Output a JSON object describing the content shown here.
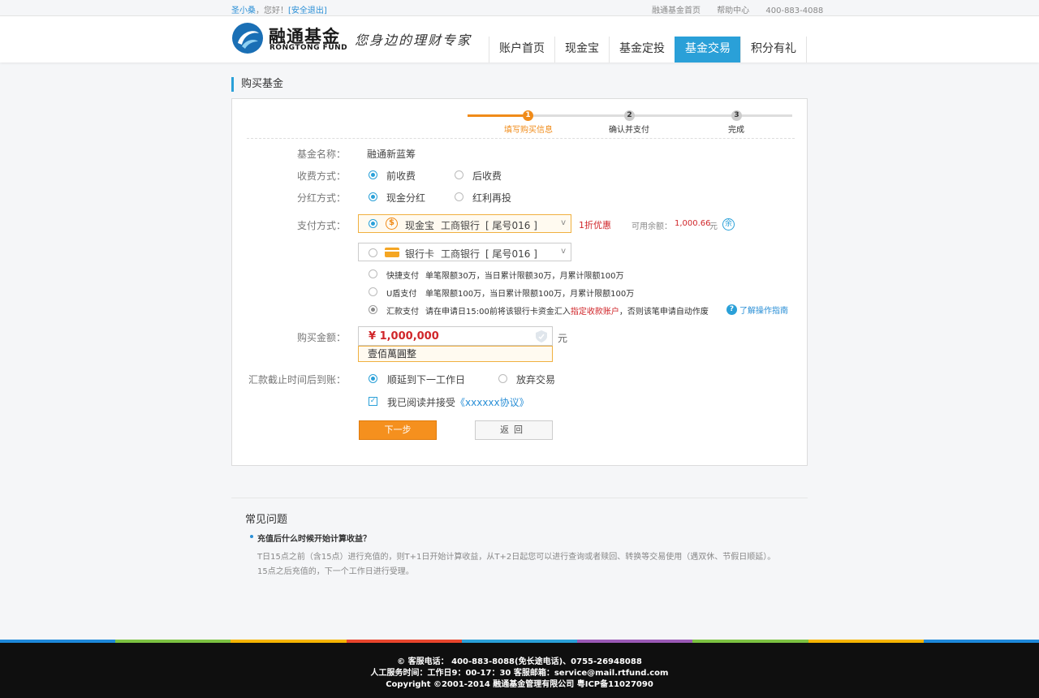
{
  "topbar": {
    "username": "圣小桑",
    "greeting": "，您好！",
    "logout": "[安全退出]",
    "links": [
      "融通基金首页",
      "帮助中心",
      "400-883-4088"
    ]
  },
  "brand": {
    "name_cn": "融通基金",
    "name_en": "RONGTONG FUND",
    "slogan": "您身边的理财专家"
  },
  "nav": {
    "items": [
      "账户首页",
      "现金宝",
      "基金定投",
      "基金交易",
      "积分有礼"
    ],
    "active": "基金交易"
  },
  "section_title": "购买基金",
  "steps": [
    "填写购买信息",
    "确认并支付",
    "完成"
  ],
  "form": {
    "fund_name_label": "基金名称：",
    "fund_name": "融通新蓝筹",
    "fee_label": "收费方式：",
    "fee_opt1": "前收费",
    "fee_opt2": "后收费",
    "div_label": "分红方式：",
    "div_opt1": "现金分红",
    "div_opt2": "红利再投",
    "pay_label": "支付方式：",
    "pay1": {
      "icon": "coin-icon",
      "name": "现金宝",
      "bank": "工商银行",
      "tail": "[ 尾号016 ]"
    },
    "discount": "1折优惠",
    "balance_label": "可用余额：",
    "balance": "1,000.66",
    "balance_unit": "元",
    "yu_icon": "余",
    "pay2": {
      "icon": "bank-card-icon",
      "name": "银行卡",
      "bank": "工商银行",
      "tail": "[ 尾号016 ]"
    },
    "methods": [
      {
        "name": "快捷支付",
        "desc": "单笔限额30万，当日累计限额30万，月累计限额100万"
      },
      {
        "name": "U盾支付",
        "desc": "单笔限额100万，当日累计限额100万，月累计限额100万"
      }
    ],
    "remit_name": "汇款支付",
    "remit_desc1": "请在申请日15:00前将该银行卡资金汇入",
    "remit_highlight": "指定收款账户",
    "remit_desc2": "，否则该笔申请自动作废",
    "guide_link": "了解操作指南",
    "amount_label": "购买金额：",
    "amount": "¥ 1,000,000",
    "amount_unit": "元",
    "amount_cn": "壹佰萬圓整",
    "cutoff_label": "汇款截止时间后到账：",
    "cutoff_opt1": "顺延到下一工作日",
    "cutoff_opt2": "放弃交易",
    "agree_text": "我已阅读并接受",
    "agree_link": "《xxxxxx协议》",
    "next_btn": "下一步",
    "back_btn": "返回"
  },
  "faq": {
    "title": "常见问题",
    "question": "充值后什么时候开始计算收益？",
    "answer_line1": "T日15点之前（含15点）进行充值的，则T+1日开始计算收益，从T+2日起您可以进行查询或者赎回、转换等交易使用（遇双休、节假日顺延）。",
    "answer_line2": "15点之后充值的，下一个工作日进行受理。"
  },
  "colors": {
    "accent": "#2aa0d8",
    "orange": "#f5901e",
    "red": "#d0262a",
    "footer_stripes": [
      "#1e88d9",
      "#7cc242",
      "#f5b400",
      "#e8452c",
      "#2aa0d8",
      "#9b59b6",
      "#7cc242",
      "#f5b400",
      "#1e88d9"
    ]
  },
  "footer": {
    "line1": "© 客服电话： 400-883-8088(免长途电话)、0755-26948088",
    "line2": "人工服务时间：工作日9：00-17：30    客服邮箱：service@mail.rtfund.com",
    "line3": "Copyright ©2001-2014 融通基金管理有限公司 粤ICP备11027090"
  }
}
